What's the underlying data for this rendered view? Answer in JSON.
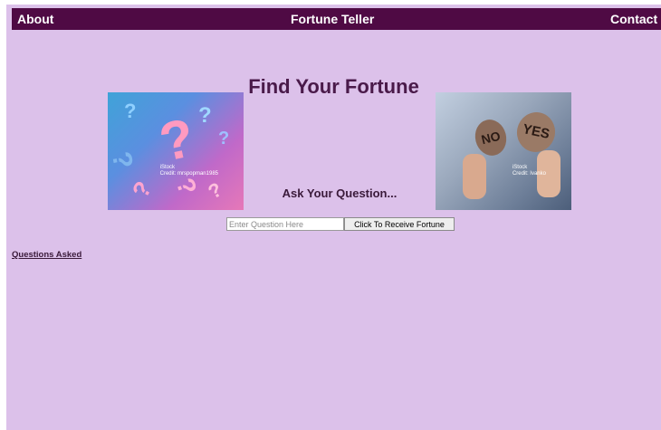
{
  "nav": {
    "about": "About",
    "title": "Fortune Teller",
    "contact": "Contact"
  },
  "main": {
    "heading": "Find Your Fortune",
    "ask_prompt": "Ask Your Question...",
    "question_input": {
      "placeholder": "Enter Question Here",
      "value": ""
    },
    "receive_button": "Click To Receive Fortune",
    "questions_link": "Questions Asked"
  },
  "images": {
    "left": {
      "icon": "question-marks-image",
      "watermark_line1": "iStock",
      "watermark_line2": "Credit: mrspopman1985"
    },
    "right": {
      "icon": "yes-no-bubbles-image",
      "bubble_no": "NO",
      "bubble_yes": "YES",
      "watermark_line1": "iStock",
      "watermark_line2": "Credit: Ivanko"
    }
  },
  "colors": {
    "page_background": "#dcc1ea",
    "navbar_background": "#4f0a44",
    "heading_text": "#4a1a4a"
  }
}
